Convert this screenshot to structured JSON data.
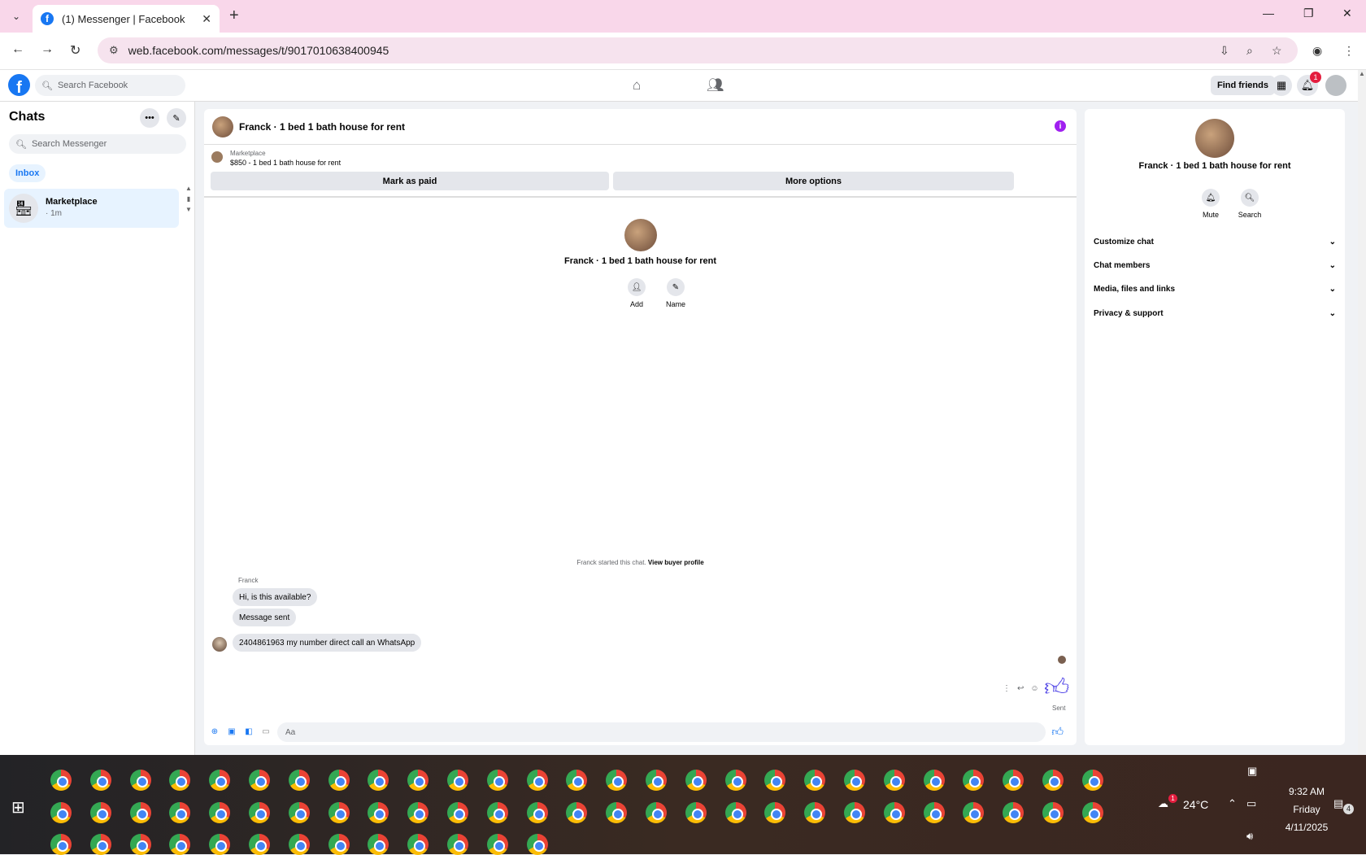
{
  "browser": {
    "tab_title": "(1) Messenger | Facebook",
    "url": "web.facebook.com/messages/t/9017010638400945",
    "new_tab_glyph": "+",
    "close_glyph": "✕"
  },
  "fb_header": {
    "search_placeholder": "Search Facebook",
    "find_friends": "Find friends",
    "notifications_count": "1"
  },
  "sidebar": {
    "title": "Chats",
    "search_placeholder": "Search Messenger",
    "filter": "Inbox",
    "chats": [
      {
        "name": "Marketplace",
        "time": "· 1m"
      }
    ]
  },
  "conversation": {
    "title": "Franck · 1 bed 1 bath house for rent",
    "listing_source": "Marketplace",
    "listing_price_title": "$850 - 1 bed 1 bath house for rent",
    "mark_paid": "Mark as paid",
    "more_options": "More options",
    "profile_name": "Franck · 1 bed 1 bath house for rent",
    "actions": [
      {
        "label": "Add"
      },
      {
        "label": "Name"
      }
    ],
    "started_text": "Franck started this chat.",
    "view_buyer_profile": "View buyer profile",
    "sender_name": "Franck",
    "messages": [
      {
        "text": "Hi, is this available?"
      },
      {
        "text": "Message sent"
      },
      {
        "text": "2404861963 my number direct call an WhatsApp"
      }
    ],
    "sent_status": "Sent",
    "composer_placeholder": "Aa"
  },
  "details": {
    "name": "Franck · 1 bed 1 bath house for rent",
    "actions": [
      {
        "label": "Mute"
      },
      {
        "label": "Search"
      }
    ],
    "sections": [
      "Customize chat",
      "Chat members",
      "Media, files and links",
      "Privacy & support"
    ]
  },
  "taskbar": {
    "weather": "24°C",
    "time": "9:32 AM",
    "day": "Friday",
    "date": "4/11/2025",
    "notif_count": "4",
    "weather_badge": "1"
  },
  "colors": {
    "accent": "#1877f2",
    "info": "#a020f0",
    "thumb": "#5b50e8",
    "tab_bar": "#f9d7ea"
  }
}
